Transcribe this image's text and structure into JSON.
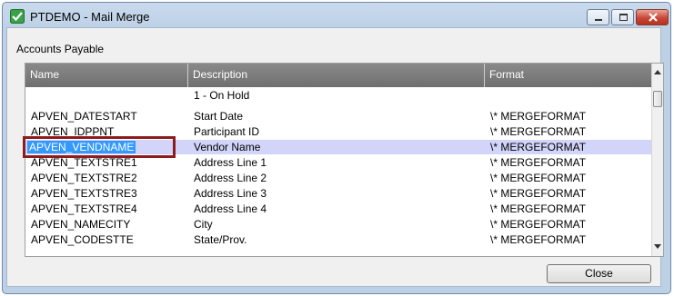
{
  "window": {
    "title": "PTDEMO - Mail Merge"
  },
  "section_label": "Accounts Payable",
  "grid": {
    "columns": [
      "Name",
      "Description",
      "Format"
    ],
    "rows": [
      {
        "name": "",
        "description": "1 - On Hold",
        "format": ""
      },
      {
        "name": "APVEN_DATESTART",
        "description": "Start Date",
        "format": "\\* MERGEFORMAT"
      },
      {
        "name": "APVEN_IDPPNT",
        "description": "Participant ID",
        "format": "\\* MERGEFORMAT"
      },
      {
        "name": "APVEN_VENDNAME",
        "description": "Vendor Name",
        "format": "\\* MERGEFORMAT"
      },
      {
        "name": "APVEN_TEXTSTRE1",
        "description": "Address Line 1",
        "format": "\\* MERGEFORMAT"
      },
      {
        "name": "APVEN_TEXTSTRE2",
        "description": "Address Line 2",
        "format": "\\* MERGEFORMAT"
      },
      {
        "name": "APVEN_TEXTSTRE3",
        "description": "Address Line 3",
        "format": "\\* MERGEFORMAT"
      },
      {
        "name": "APVEN_TEXTSTRE4",
        "description": "Address Line 4",
        "format": "\\* MERGEFORMAT"
      },
      {
        "name": "APVEN_NAMECITY",
        "description": "City",
        "format": "\\* MERGEFORMAT"
      },
      {
        "name": "APVEN_CODESTTE",
        "description": "State/Prov.",
        "format": "\\* MERGEFORMAT"
      }
    ],
    "selected_row_index": 3
  },
  "buttons": {
    "close_label": "Close"
  },
  "colors": {
    "header_bg": "#7a7a7a",
    "selected_row_bg": "#d3d4fa",
    "selection_bg": "#3399ff",
    "annotation_box": "#8b1d1d"
  },
  "icons": {
    "app": "green-check-icon",
    "minimize": "minimize-icon",
    "maximize": "maximize-icon",
    "close": "close-icon"
  }
}
